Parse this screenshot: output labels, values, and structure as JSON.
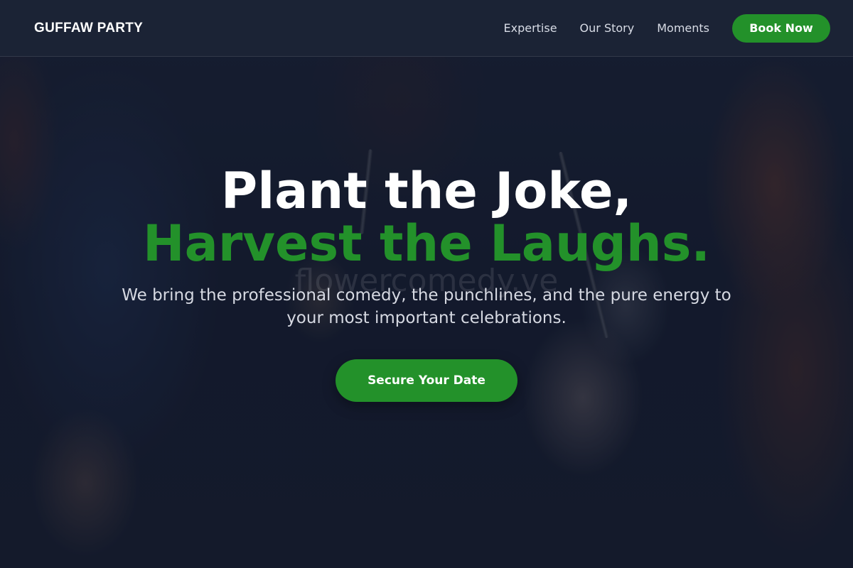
{
  "header": {
    "brand": "GUFFAW PARTY",
    "nav": [
      {
        "label": "Expertise"
      },
      {
        "label": "Our Story"
      },
      {
        "label": "Moments"
      }
    ],
    "cta_label": "Book Now"
  },
  "hero": {
    "headline_line1": "Plant the Joke,",
    "headline_line2": "Harvest the Laughs.",
    "subtext": "We bring the professional comedy, the punchlines, and the pure energy to your most important celebrations.",
    "watermark": "flowercomedy.ve",
    "cta_label": "Secure Your Date"
  },
  "colors": {
    "accent": "#23912a",
    "header_bg": "#1c2336",
    "text_primary": "#ffffff",
    "text_secondary": "#d6d9e2"
  }
}
